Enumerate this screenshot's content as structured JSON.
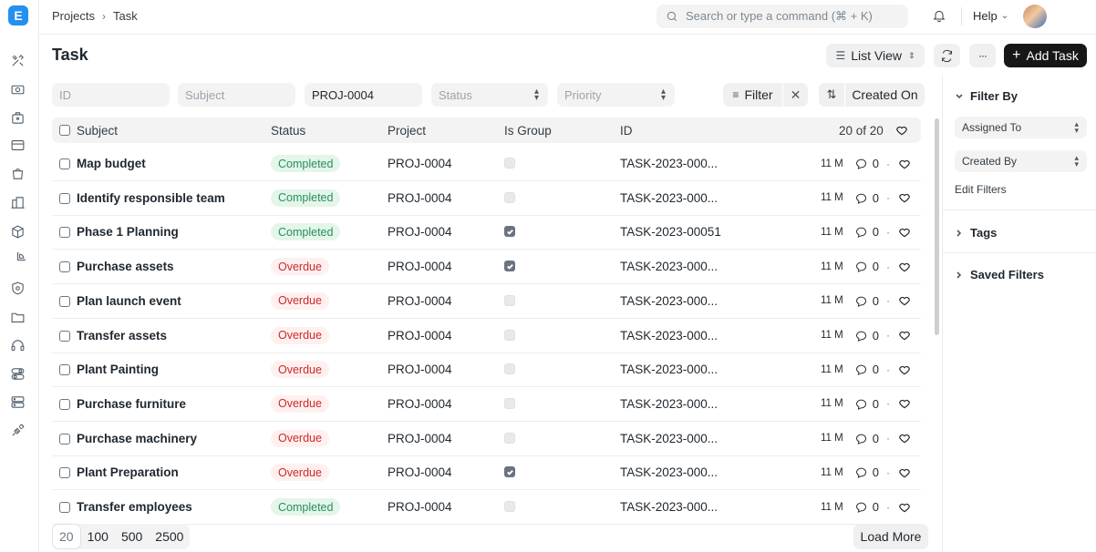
{
  "nav": {
    "logo_letter": "E",
    "rail_icons": [
      "tools-icon",
      "projector-icon",
      "briefcase-icon",
      "card-icon",
      "bag-icon",
      "building-icon",
      "box-icon",
      "pie-chart-icon",
      "shield-icon",
      "folder-icon",
      "headset-icon",
      "toggle-icon",
      "server-icon",
      "plug-icon"
    ]
  },
  "topbar": {
    "breadcrumbs": [
      "Projects",
      "Task"
    ],
    "search_placeholder": "Search or type a command (⌘ + K)",
    "help_label": "Help"
  },
  "page": {
    "title": "Task",
    "view_label": "List View",
    "more_label": "···",
    "add_label": "Add Task"
  },
  "filters": {
    "id_placeholder": "ID",
    "subject_placeholder": "Subject",
    "project_value": "PROJ-0004",
    "status_placeholder": "Status",
    "priority_placeholder": "Priority",
    "filter_label": "Filter",
    "sort_label": "Created On"
  },
  "table": {
    "columns": [
      "Subject",
      "Status",
      "Project",
      "Is Group",
      "ID"
    ],
    "count_label": "20 of 20",
    "rows": [
      {
        "subject": "Map budget",
        "status": "Completed",
        "project": "PROJ-0004",
        "is_group": false,
        "id": "TASK-2023-000...",
        "age": "11 M",
        "comments": "0"
      },
      {
        "subject": "Identify responsible team",
        "status": "Completed",
        "project": "PROJ-0004",
        "is_group": false,
        "id": "TASK-2023-000...",
        "age": "11 M",
        "comments": "0"
      },
      {
        "subject": "Phase 1 Planning",
        "status": "Completed",
        "project": "PROJ-0004",
        "is_group": true,
        "id": "TASK-2023-00051",
        "age": "11 M",
        "comments": "0"
      },
      {
        "subject": "Purchase assets",
        "status": "Overdue",
        "project": "PROJ-0004",
        "is_group": true,
        "id": "TASK-2023-000...",
        "age": "11 M",
        "comments": "0"
      },
      {
        "subject": "Plan launch event",
        "status": "Overdue",
        "project": "PROJ-0004",
        "is_group": false,
        "id": "TASK-2023-000...",
        "age": "11 M",
        "comments": "0"
      },
      {
        "subject": "Transfer assets",
        "status": "Overdue",
        "project": "PROJ-0004",
        "is_group": false,
        "id": "TASK-2023-000...",
        "age": "11 M",
        "comments": "0"
      },
      {
        "subject": "Plant Painting",
        "status": "Overdue",
        "project": "PROJ-0004",
        "is_group": false,
        "id": "TASK-2023-000...",
        "age": "11 M",
        "comments": "0"
      },
      {
        "subject": "Purchase furniture",
        "status": "Overdue",
        "project": "PROJ-0004",
        "is_group": false,
        "id": "TASK-2023-000...",
        "age": "11 M",
        "comments": "0"
      },
      {
        "subject": "Purchase machinery",
        "status": "Overdue",
        "project": "PROJ-0004",
        "is_group": false,
        "id": "TASK-2023-000...",
        "age": "11 M",
        "comments": "0"
      },
      {
        "subject": "Plant Preparation",
        "status": "Overdue",
        "project": "PROJ-0004",
        "is_group": true,
        "id": "TASK-2023-000...",
        "age": "11 M",
        "comments": "0"
      },
      {
        "subject": "Transfer employees",
        "status": "Completed",
        "project": "PROJ-0004",
        "is_group": false,
        "id": "TASK-2023-000...",
        "age": "11 M",
        "comments": "0"
      }
    ]
  },
  "footer": {
    "page_sizes": [
      "20",
      "100",
      "500",
      "2500"
    ],
    "load_more_label": "Load More"
  },
  "sidebar": {
    "filter_by_label": "Filter By",
    "assigned_to_label": "Assigned To",
    "created_by_label": "Created By",
    "edit_filters_label": "Edit Filters",
    "tags_label": "Tags",
    "saved_filters_label": "Saved Filters"
  },
  "colors": {
    "completed_bg": "#e4f5e9",
    "completed_text": "#278f5e",
    "overdue_bg": "#fff0f0",
    "overdue_text": "#cc2929",
    "logo": "#2490ef"
  }
}
